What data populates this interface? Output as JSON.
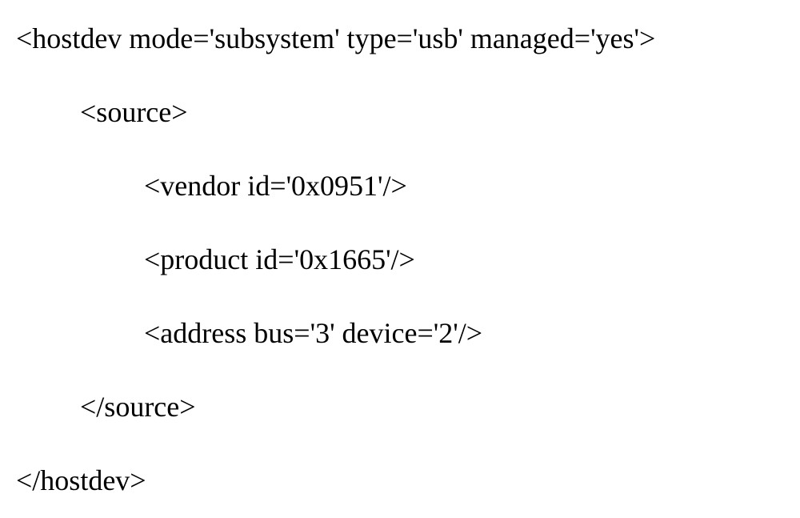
{
  "xml": {
    "line1": "<hostdev mode='subsystem' type='usb' managed='yes'>",
    "line2": "<source>",
    "line3": "<vendor id='0x0951'/>",
    "line4": "<product id='0x1665'/>",
    "line5": "<address bus='3' device='2'/>",
    "line6": "</source>",
    "line7": "</hostdev>"
  }
}
